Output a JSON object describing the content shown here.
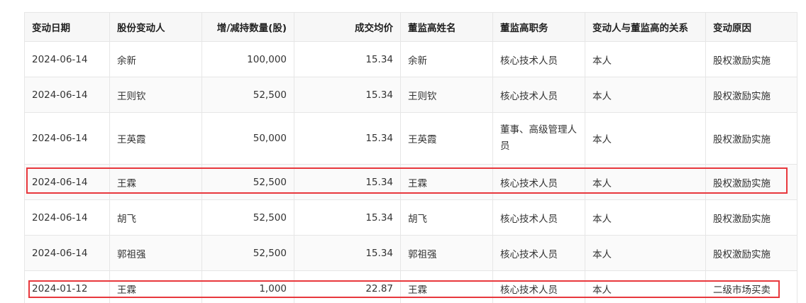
{
  "table": {
    "headers": [
      "变动日期",
      "股份变动人",
      "增/减持数量(股)",
      "成交均价",
      "董监高姓名",
      "董监高职务",
      "变动人与董监高的关系",
      "变动原因"
    ],
    "rows": [
      [
        "2024-06-14",
        "余新",
        "100,000",
        "15.34",
        "余新",
        "核心技术人员",
        "本人",
        "股权激励实施"
      ],
      [
        "2024-06-14",
        "王则钦",
        "52,500",
        "15.34",
        "王则钦",
        "核心技术人员",
        "本人",
        "股权激励实施"
      ],
      [
        "2024-06-14",
        "王英霞",
        "50,000",
        "15.34",
        "王英霞",
        "董事、高级管理人员",
        "本人",
        "股权激励实施"
      ],
      [
        "2024-06-14",
        "王霖",
        "52,500",
        "15.34",
        "王霖",
        "核心技术人员",
        "本人",
        "股权激励实施"
      ],
      [
        "2024-06-14",
        "胡飞",
        "52,500",
        "15.34",
        "胡飞",
        "核心技术人员",
        "本人",
        "股权激励实施"
      ],
      [
        "2024-06-14",
        "郭祖强",
        "52,500",
        "15.34",
        "郭祖强",
        "核心技术人员",
        "本人",
        "股权激励实施"
      ],
      [
        "2024-01-12",
        "王霖",
        "1,000",
        "22.87",
        "王霖",
        "核心技术人员",
        "本人",
        "二级市场买卖"
      ]
    ]
  },
  "highlight_color": "#e8383d"
}
